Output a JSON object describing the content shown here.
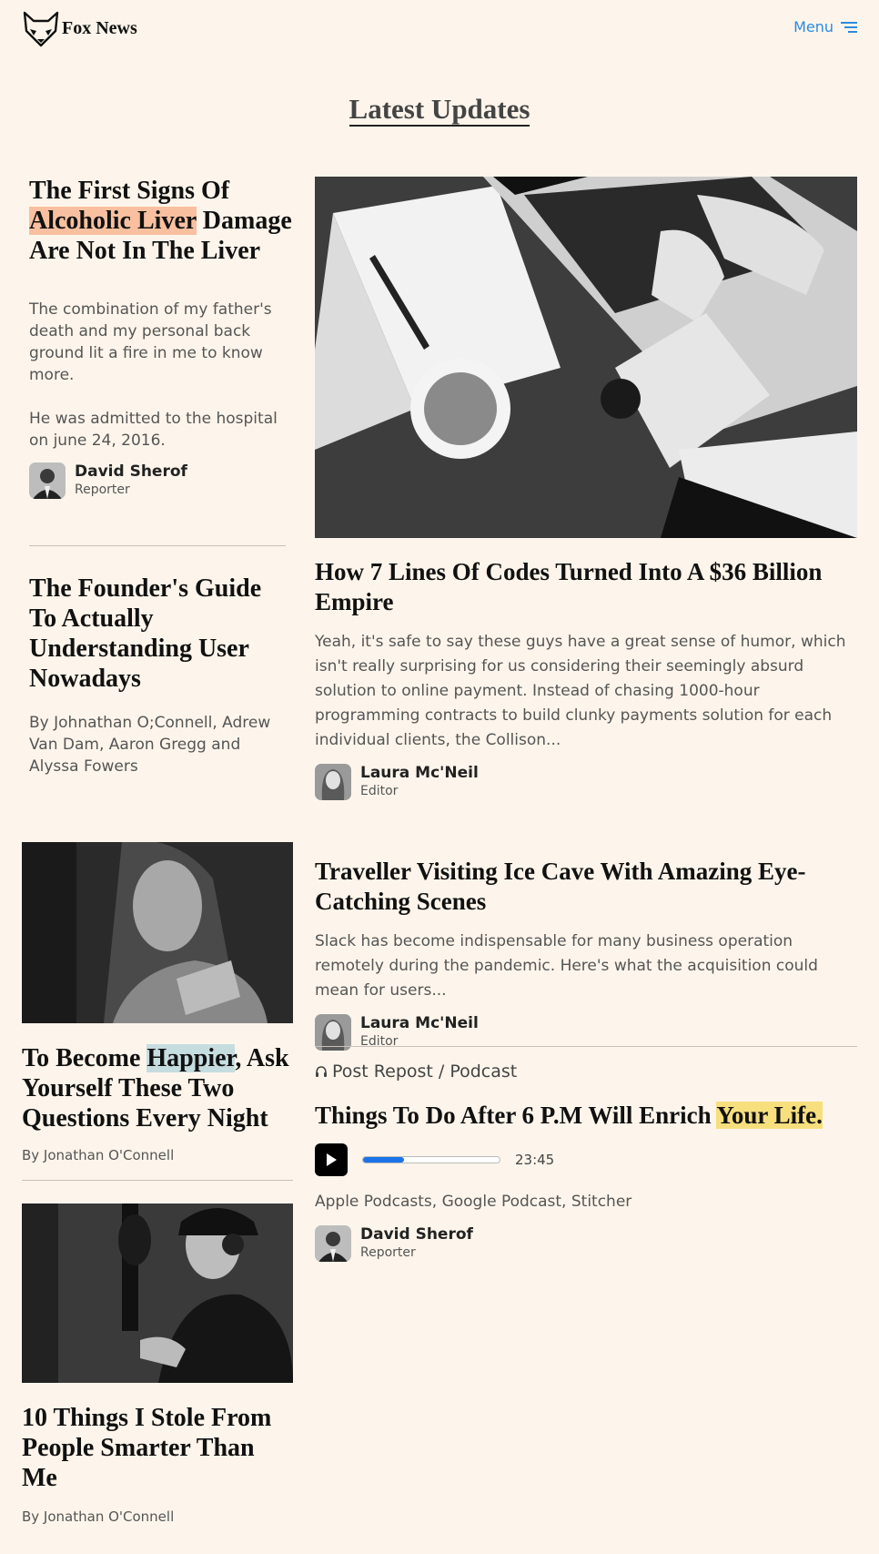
{
  "header": {
    "brand": "Fox News",
    "menu_label": "Menu",
    "logo_icon": "fox-head-icon",
    "menu_icon": "hamburger-menu-icon"
  },
  "section_title": "Latest Updates",
  "colors": {
    "background": "#fdf5eb",
    "accent": "#2b8be0",
    "highlight_orange": "#f9c0a0",
    "highlight_blue": "#c6dde0",
    "highlight_yellow": "#f7df7e"
  },
  "articles": {
    "liver": {
      "title_pre": "The First Signs Of",
      "title_highlight": "Alcoholic Liver",
      "title_post": "Damage Are Not In The Liver",
      "para1": "The combination of my father's death and my personal back ground lit a fire in me to know more.",
      "para2": "He was admitted to the hospital on june 24, 2016.",
      "author_name": "David Sherof",
      "author_role": "Reporter"
    },
    "founder": {
      "title": "The Founder's Guide To Actually Understanding User Nowadays",
      "byline": "By Johnathan O;Connell, Adrew Van Dam, Aaron Gregg and Alyssa Fowers"
    },
    "codes": {
      "title": "How 7 Lines Of Codes Turned Into A $36 Billion Empire",
      "excerpt": "Yeah, it's safe to say these guys have a great sense of humor, which isn't really surprising for us considering their seemingly absurd solution to online payment. Instead of chasing 1000-hour programming contracts to build clunky payments solution for each individual clients, the Collison...",
      "author_name": "Laura Mc'Neil",
      "author_role": "Editor"
    },
    "happier": {
      "title_pre": "To Become",
      "title_highlight": "Happier",
      "title_post": ", Ask Yourself These Two Questions Every Night",
      "byline": "By Jonathan O'Connell"
    },
    "cave": {
      "title": "Traveller Visiting Ice Cave With Amazing Eye-Catching Scenes",
      "excerpt": "Slack has become indispensable for many business operation remotely during the pandemic. Here's what the acquisition could mean for users...",
      "author_name": "Laura Mc'Neil",
      "author_role": "Editor"
    },
    "podcast": {
      "label": "Post Repost / Podcast",
      "title_pre": "Things To Do After 6 P.M Will Enrich",
      "title_highlight": "Your Life.",
      "duration": "23:45",
      "progress": 0.3,
      "platforms": "Apple Podcasts, Google Podcast, Stitcher",
      "author_name": "David Sherof",
      "author_role": "Reporter"
    },
    "stole": {
      "title": "10 Things I Stole From People Smarter Than Me",
      "byline": "By Jonathan O'Connell"
    }
  }
}
